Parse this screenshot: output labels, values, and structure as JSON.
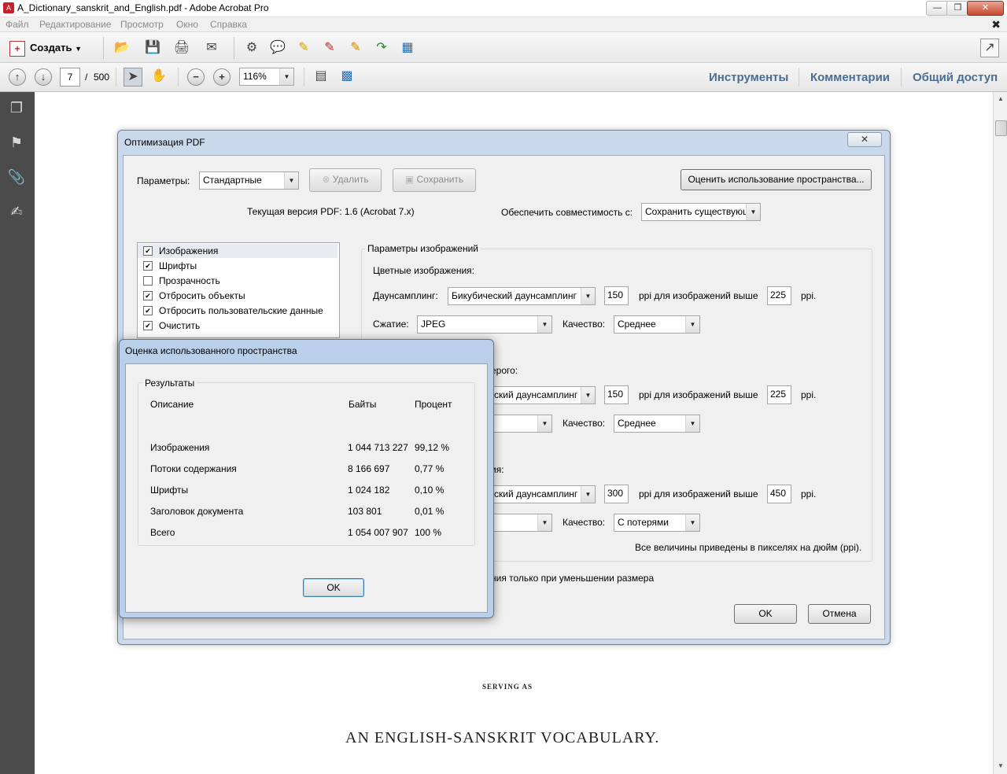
{
  "window": {
    "title": "A_Dictionary_sanskrit_and_English.pdf - Adobe Acrobat Pro"
  },
  "menu": {
    "file": "Файл",
    "edit": "Редактирование",
    "view": "Просмотр",
    "window": "Окно",
    "help": "Справка"
  },
  "toolbar": {
    "create_label": "Создать"
  },
  "nav": {
    "page_current": "7",
    "page_sep": "/",
    "page_total": "500",
    "zoom": "116%"
  },
  "panels": {
    "tools": "Инструменты",
    "comments": "Комментарии",
    "share": "Общий доступ"
  },
  "document": {
    "line_serving": "SERVING AS",
    "line_vocab": "AN  ENGLISH-SANSKRIT  VOCABULARY."
  },
  "optimize_dialog": {
    "title": "Оптимизация PDF",
    "params_label": "Параметры:",
    "params_value": "Стандартные",
    "delete_btn": "Удалить",
    "save_btn": "Сохранить",
    "audit_btn": "Оценить использование пространства...",
    "current_version": "Текущая версия PDF: 1.6 (Acrobat 7.x)",
    "compat_label": "Обеспечить совместимость с:",
    "compat_value": "Сохранить существующ",
    "categories": [
      {
        "label": "Изображения",
        "checked": true
      },
      {
        "label": "Шрифты",
        "checked": true
      },
      {
        "label": "Прозрачность",
        "checked": false
      },
      {
        "label": "Отбросить объекты",
        "checked": true
      },
      {
        "label": "Отбросить пользовательские данные",
        "checked": true
      },
      {
        "label": "Очистить",
        "checked": true
      }
    ],
    "image_settings_title": "Параметры изображений",
    "color_images_title": "Цветные изображения:",
    "grayscale_title_partial": "ерого:",
    "mono_title_partial": "ия:",
    "downsample_label": "Даунсамплинг:",
    "downsample_value": "Бикубический даунсамплинг",
    "downsample_value_partial": "ский даунсамплинг",
    "ppi_above_label": "ppi для изображений выше",
    "ppi_unit": "ppi.",
    "compression_label": "Сжатие:",
    "compression_value": "JPEG",
    "quality_label": "Качество:",
    "quality_medium": "Среднее",
    "quality_lossy": "С потерями",
    "color_ppi": "150",
    "color_above": "225",
    "gray_ppi": "150",
    "gray_above": "225",
    "mono_ppi": "300",
    "mono_above": "450",
    "note": "Все величины приведены в пикселях на дюйм (ppi).",
    "optimize_only_partial": "ния только при уменьшении размера",
    "ok_btn": "OK",
    "cancel_btn": "Отмена"
  },
  "usage_dialog": {
    "title": "Оценка использованного пространства",
    "group_title": "Результаты",
    "col_desc": "Описание",
    "col_bytes": "Байты",
    "col_percent": "Процент",
    "rows": [
      {
        "desc": "Изображения",
        "bytes": "1 044 713 227",
        "percent": "99,12 %"
      },
      {
        "desc": "Потоки содержания",
        "bytes": "8 166 697",
        "percent": "0,77 %"
      },
      {
        "desc": "Шрифты",
        "bytes": "1 024 182",
        "percent": "0,10 %"
      },
      {
        "desc": "Заголовок документа",
        "bytes": "103 801",
        "percent": "0,01 %"
      },
      {
        "desc": "Всего",
        "bytes": "1 054 007 907",
        "percent": "100 %"
      }
    ],
    "ok_btn": "OK"
  }
}
